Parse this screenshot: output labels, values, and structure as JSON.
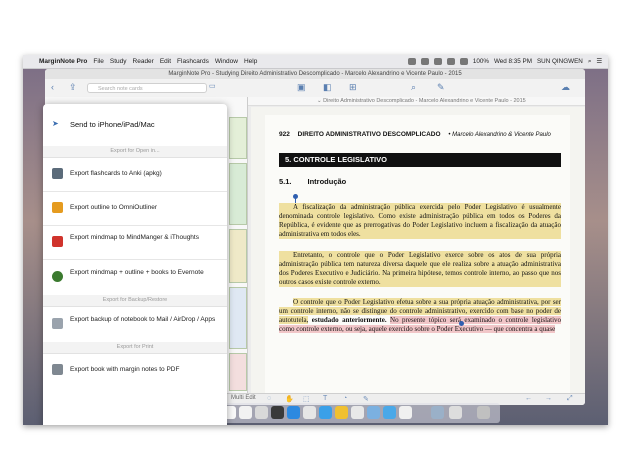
{
  "menubar": {
    "apple": "",
    "app": "MarginNote Pro",
    "items": [
      "File",
      "Study",
      "Reader",
      "Edit",
      "Flashcards",
      "Window",
      "Help"
    ],
    "battery": "100%",
    "clock": "Wed 8:35 PM",
    "user": "SUN QINGWEN"
  },
  "window": {
    "title": "MarginNote Pro - Studying Direito Administrativo Descomplicado - Marcelo Alexandrino e Vicente Paulo - 2015",
    "search_placeholder": "Search note cards",
    "breadcrumb": "Direito Administrativo Descomplicado - Marcelo Alexandrino e Vicente Paulo - 2015"
  },
  "popup": {
    "send_label": "Send to iPhone/iPad/Mac",
    "headers": {
      "open_in": "Export for Open in...",
      "backup": "Export for Backup/Restore",
      "print": "Export for Print"
    },
    "items": [
      {
        "label": "Export flashcards to Anki (apkg)",
        "icon": "anki-icon",
        "color": "#5b6b7a"
      },
      {
        "label": "Export outline to OmniOutliner",
        "icon": "omnioutliner-icon",
        "color": "#e59b1f"
      },
      {
        "label": "Export mindmap to MindManger & iThoughts",
        "icon": "mindmanager-icon",
        "color": "#d0332c"
      },
      {
        "label": "Export mindmap + outline + books to Evernote",
        "icon": "evernote-icon",
        "color": "#3b7a2f"
      },
      {
        "label": "Export backup of notebook to Mail / AirDrop / Apps",
        "icon": "share-icon",
        "color": "#9aa3ad"
      },
      {
        "label": "Export book with margin notes to PDF",
        "icon": "print-icon",
        "color": "#7f8891"
      }
    ]
  },
  "document": {
    "page_number": "922",
    "running_title": "DIREITO ADMINISTRATIVO DESCOMPLICADO",
    "authors": "• Marcelo Alexandrino & Vicente Paulo",
    "section": "5.     CONTROLE LEGISLATIVO",
    "subsection_num": "5.1.",
    "subsection_title": "Introdução",
    "p1": "A fiscalização da administração pública exercida pelo Poder Legislativo é usualmente denominada controle legislativo. Como existe administração pública em todos os Poderes da República, é evidente que as prerrogativas do Poder Legislativo incluem a fiscalização da atuação administrativa em todos eles.",
    "p2": "Entretanto, o controle que o Poder Legislativo exerce sobre os atos de sua própria administração pública tem natureza diversa daquele que ele realiza sobre a atuação administrativa dos Poderes Executivo e Judiciário. Na primeira hipótese, temos controle interno, ao passo que nos outros casos existe controle externo.",
    "p3a": "O controle que o Poder Legislativo efetua sobre a sua própria atuação administrativa, por ser um controle interno, não se distingue do controle administrativo, exercido com base no poder de autotutela,",
    "p3b": "estudado anteriormente.",
    "p3c": "No presente tópico será examinado o controle legislativo como controle externo, ou seja, aquele exercido sobre o Poder Executivo — que concentra a quase"
  },
  "bottombar": {
    "edit_label": "Multi Edit"
  }
}
